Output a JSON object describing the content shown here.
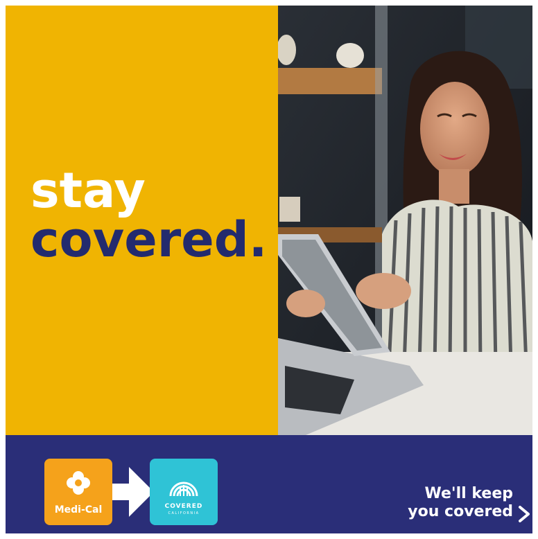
{
  "headline": {
    "line1": "stay",
    "line2": "covered."
  },
  "logos": {
    "medi_cal": {
      "label": "Medi-Cal",
      "icon": "poppy-flower-icon"
    },
    "covered_california": {
      "label": "COVERED",
      "sublabel": "CALIFORNIA",
      "icon": "covered-california-emblem-icon"
    },
    "transition_arrow": "right-arrow-icon"
  },
  "cta": {
    "line1": "We'll keep",
    "line2": "you covered",
    "icon": "chevron-right-icon"
  },
  "photo": {
    "subject": "woman-using-tablet-photo"
  },
  "colors": {
    "yellow": "#f0b402",
    "navy": "#2a2e78",
    "headline_navy": "#232b6e",
    "medi_cal_orange": "#f5a21b",
    "covered_teal": "#2fc3d6"
  }
}
